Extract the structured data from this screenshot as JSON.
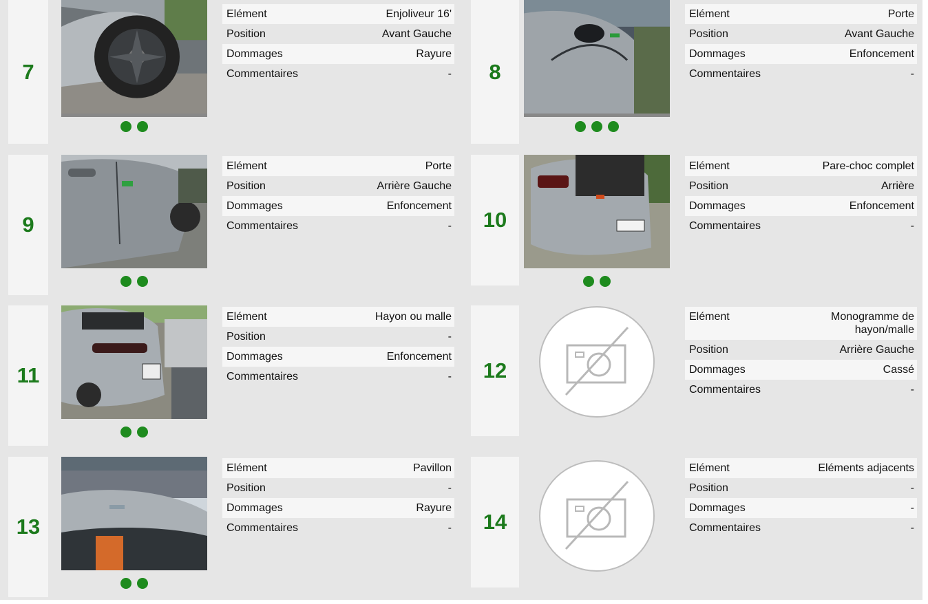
{
  "labels": {
    "element": "Elément",
    "position": "Position",
    "damage": "Dommages",
    "comments": "Commentaires"
  },
  "items": [
    {
      "number": "7",
      "element": "Enjoliveur 16'",
      "position": "Avant Gauche",
      "damage": "Rayure",
      "comments": "-",
      "photo": "wheel-photo",
      "photo_count": 2
    },
    {
      "number": "8",
      "element": "Porte",
      "position": "Avant Gauche",
      "damage": "Enfoncement",
      "comments": "-",
      "photo": "front-door-photo",
      "photo_count": 3
    },
    {
      "number": "9",
      "element": "Porte",
      "position": "Arrière Gauche",
      "damage": "Enfoncement",
      "comments": "-",
      "photo": "rear-door-photo",
      "photo_count": 2
    },
    {
      "number": "10",
      "element": "Pare-choc complet",
      "position": "Arrière",
      "damage": "Enfoncement",
      "comments": "-",
      "photo": "rear-bumper-photo",
      "photo_count": 2
    },
    {
      "number": "11",
      "element": "Hayon ou malle",
      "position": "-",
      "damage": "Enfoncement",
      "comments": "-",
      "photo": "tailgate-photo",
      "photo_count": 2
    },
    {
      "number": "12",
      "element": "Monogramme de hayon/malle",
      "position": "Arrière Gauche",
      "damage": "Cassé",
      "comments": "-",
      "photo": "no-photo-icon",
      "photo_count": 0
    },
    {
      "number": "13",
      "element": "Pavillon",
      "position": "-",
      "damage": "Rayure",
      "comments": "-",
      "photo": "roof-photo",
      "photo_count": 2
    },
    {
      "number": "14",
      "element": "Eléments adjacents",
      "position": "-",
      "damage": "-",
      "comments": "-",
      "photo": "no-photo-icon",
      "photo_count": 0
    }
  ],
  "colors": {
    "background": "#e6e6e6",
    "number_green": "#1c7a1c",
    "dot_green": "#1e8b1e"
  }
}
